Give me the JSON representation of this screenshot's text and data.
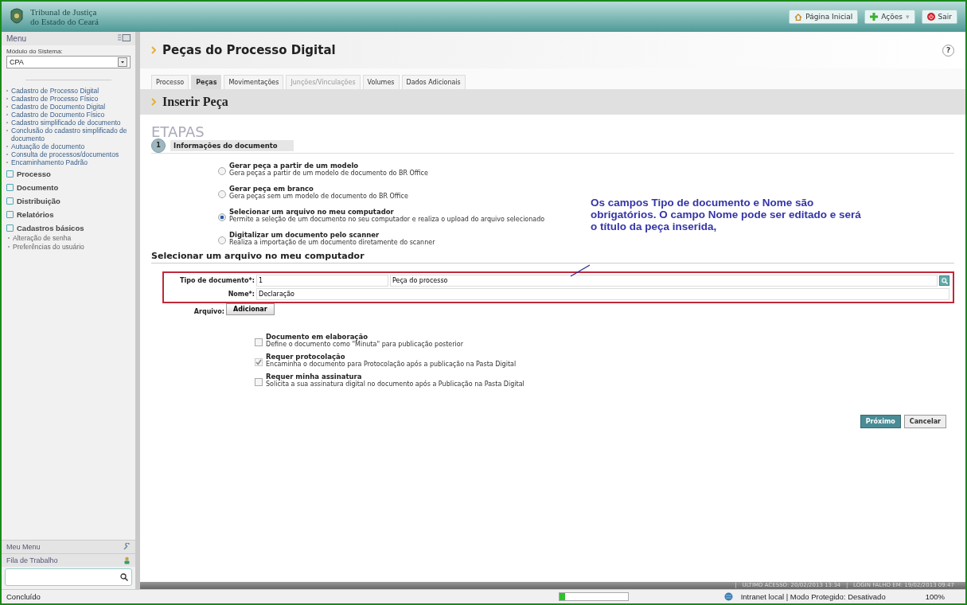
{
  "header": {
    "logo_line1": "Tribunal de Justiça",
    "logo_line2": "do Estado do Ceará",
    "buttons": [
      {
        "kind": "home",
        "label": "Página Inicial"
      },
      {
        "kind": "actions",
        "label": "Ações",
        "caret": "▾"
      },
      {
        "kind": "exit",
        "label": "Sair"
      }
    ]
  },
  "sidebar": {
    "menu_title": "Menu",
    "module_label": "Módulo do Sistema:",
    "module_value": "CPA",
    "links": [
      {
        "label": "Cadastro de Processo Digital"
      },
      {
        "label": "Cadastro de Processo Físico"
      },
      {
        "label": "Cadastro de Documento Digital"
      },
      {
        "label": "Cadastro de Documento Físico"
      },
      {
        "label": "Cadastro simplificado de documento"
      },
      {
        "label": "Conclusão do cadastro simplificado de documento"
      },
      {
        "label": "Autuação de documento"
      },
      {
        "label": "Consulta de processos/documentos"
      },
      {
        "label": "Encaminhamento Padrão"
      }
    ],
    "groups": [
      {
        "label": "Processo"
      },
      {
        "label": "Documento"
      },
      {
        "label": "Distribuição"
      },
      {
        "label": "Relatórios"
      },
      {
        "label": "Cadastros básicos",
        "children": [
          {
            "label": "Alteração de senha"
          },
          {
            "label": "Preferências do usuário"
          }
        ]
      }
    ],
    "bottom": [
      {
        "label": "Meu Menu",
        "kind": "wrench"
      },
      {
        "label": "Fila de Trabalho",
        "kind": "person"
      }
    ]
  },
  "page": {
    "title": "Peças do Processo Digital",
    "help": "?",
    "tabs": [
      {
        "label": "Processo",
        "selected": false,
        "disabled": false
      },
      {
        "label": "Peças",
        "selected": true,
        "disabled": false
      },
      {
        "label": "Movimentações",
        "selected": false,
        "disabled": false
      },
      {
        "label": "Junções/Vinculações",
        "selected": false,
        "disabled": true
      },
      {
        "label": "Volumes",
        "selected": false,
        "disabled": false
      },
      {
        "label": "Dados Adicionais",
        "selected": false,
        "disabled": false
      }
    ],
    "subtitle": "Inserir Peça",
    "steps_heading": "ETAPAS",
    "step_number": "1",
    "step_label": "Informações do documento",
    "options": [
      {
        "title": "Gerar peça a partir de um modelo",
        "description": "Gera peças a partir de um modelo de documento do BR Office",
        "selected": false
      },
      {
        "title": "Gerar peça em branco",
        "description": "Gera peças sem um modelo de documento do BR Office",
        "selected": false
      },
      {
        "title": "Selecionar um arquivo no meu computador",
        "description": "Permite a seleção de um documento no seu computador e realiza o upload do arquivo selecionado",
        "selected": true
      },
      {
        "title": "Digitalizar um documento pelo scanner",
        "description": "Realiza a importação de um documento diretamente do scanner",
        "selected": false
      }
    ],
    "annotation": "Os campos Tipo de documento e Nome são obrigatórios. O campo Nome pode ser editado e será o título da peça inserida,",
    "section_title": "Selecionar um arquivo no meu computador",
    "doc_type_label": "Tipo de documento*:",
    "doc_type_code": "1",
    "doc_type_name": "Peça do processo",
    "name_label": "Nome*:",
    "name_value": "Declaração",
    "file_label": "Arquivo:",
    "add_button": "Adicionar",
    "checks": [
      {
        "title": "Documento em elaboração",
        "description": "Define o documento como \"Minuta\" para publicação posterior",
        "checked": false,
        "disabled": false
      },
      {
        "title": "Requer protocolação",
        "description": "Encaminha o documento para Protocolação após a publicação na Pasta Digital",
        "checked": true,
        "disabled": true
      },
      {
        "title": "Requer minha assinatura",
        "description": "Solicita a sua assinatura digital no documento após a Publicação na Pasta Digital",
        "checked": false,
        "disabled": false
      }
    ],
    "next_button": "Próximo",
    "cancel_button": "Cancelar"
  },
  "footer": {
    "last_access": "|   ÚLTIMO ACESSO: 20/02/2013 13:34   |   LOGIN FALHO EM: 19/02/2013 09:47"
  },
  "status_bar": {
    "text": "Concluído",
    "progress": {
      "level": 0.08
    },
    "zone": "Intranet local | Modo Protegido: Desativado",
    "zoom": "100%"
  }
}
